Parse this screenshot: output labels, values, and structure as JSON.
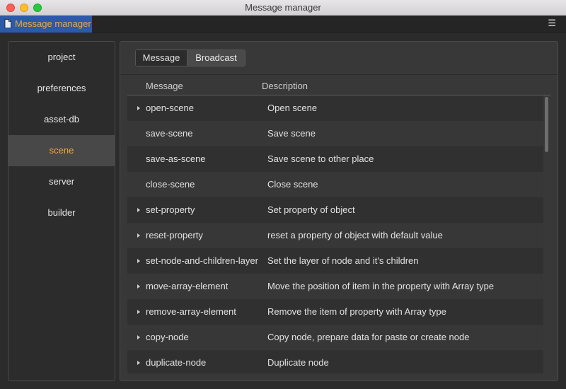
{
  "window": {
    "title": "Message manager"
  },
  "tab": {
    "label": "Message manager"
  },
  "sidebar": {
    "items": [
      {
        "label": "project",
        "active": false
      },
      {
        "label": "preferences",
        "active": false
      },
      {
        "label": "asset-db",
        "active": false
      },
      {
        "label": "scene",
        "active": true
      },
      {
        "label": "server",
        "active": false
      },
      {
        "label": "builder",
        "active": false
      }
    ]
  },
  "segment": {
    "message_label": "Message",
    "broadcast_label": "Broadcast"
  },
  "table": {
    "headers": {
      "message": "Message",
      "description": "Description"
    },
    "rows": [
      {
        "message": "open-scene",
        "description": "Open scene",
        "expandable": true
      },
      {
        "message": "save-scene",
        "description": "Save scene",
        "expandable": false
      },
      {
        "message": "save-as-scene",
        "description": "Save scene to other place",
        "expandable": false
      },
      {
        "message": "close-scene",
        "description": "Close scene",
        "expandable": false
      },
      {
        "message": "set-property",
        "description": "Set property of object",
        "expandable": true
      },
      {
        "message": "reset-property",
        "description": "reset a property of object with default value",
        "expandable": true
      },
      {
        "message": "set-node-and-children-layer",
        "description": "Set the layer of node and it's children",
        "expandable": true
      },
      {
        "message": "move-array-element",
        "description": "Move the position of item in the property with Array type",
        "expandable": true
      },
      {
        "message": "remove-array-element",
        "description": "Remove the item of property with Array type",
        "expandable": true
      },
      {
        "message": "copy-node",
        "description": "Copy node, prepare data for paste or create node",
        "expandable": true
      },
      {
        "message": "duplicate-node",
        "description": "Duplicate node",
        "expandable": true
      }
    ]
  },
  "colors": {
    "accent": "#f2a640",
    "tab_bg": "#2b5aa8"
  },
  "icons": {
    "tab": "document-icon",
    "menu": "hamburger-menu-icon",
    "row": "caret-right-icon"
  }
}
